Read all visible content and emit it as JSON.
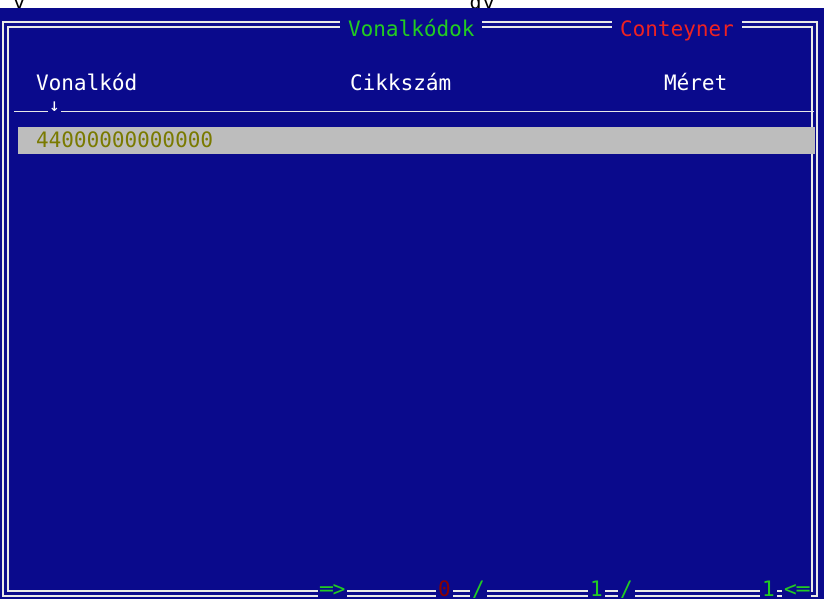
{
  "top_strip_text": "_y  _ _  _   _ _ _  _ _ _ _ _ _ _ _ _ _   _gy  _ _  _ _ _ _ _ _  _ _  _ _ _ _ _ _ _ _  _y",
  "window": {
    "background": "#0a0a8c",
    "tabs": {
      "active_label": "Vonalkódok",
      "inactive_label": "Conteyner"
    }
  },
  "table": {
    "columns": [
      "Vonalkód",
      "Cikkszám",
      "Méret"
    ],
    "sort_indicator": "↓",
    "rows": [
      {
        "vonalkod": "44000000000000",
        "cikkszam": "",
        "meret": ""
      }
    ],
    "selected_row_index": 0
  },
  "status_bar": {
    "arrow_right": "═>",
    "marked_count": "0",
    "separator": "/",
    "current_position": "1",
    "total": "1",
    "arrow_left": "<═"
  },
  "colors": {
    "background_blue": "#0a0a8c",
    "frame": "#e8e8e8",
    "active_title": "#22cc22",
    "inactive_title": "#ee2222",
    "selected_row": "#bdbdbd",
    "selected_text": "#7a7a00"
  }
}
